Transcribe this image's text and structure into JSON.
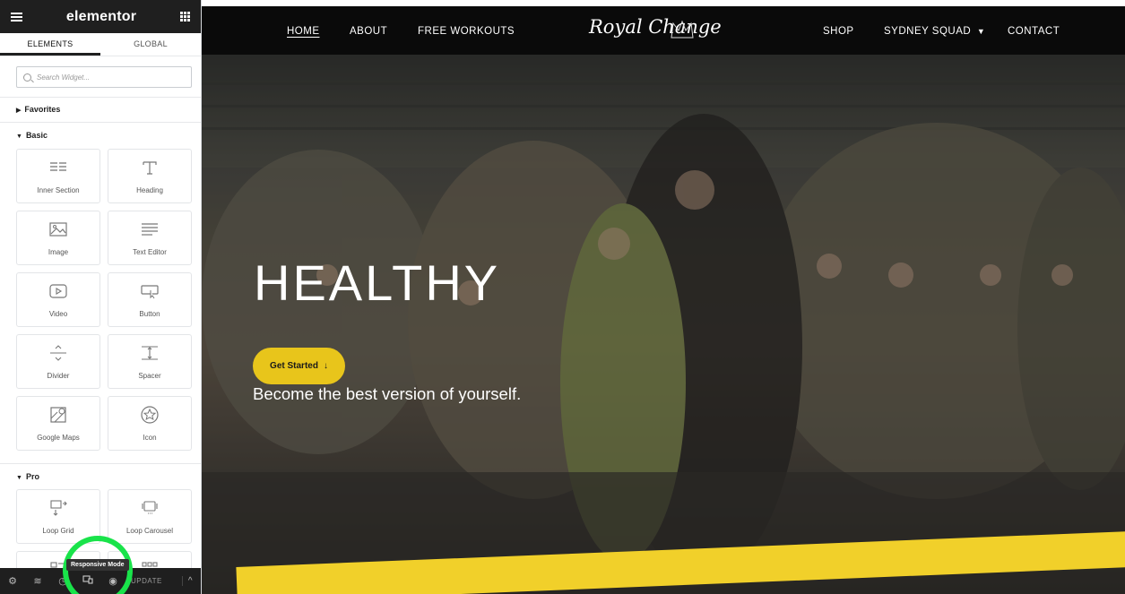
{
  "editor": {
    "logo": "elementor",
    "tabs": [
      {
        "label": "ELEMENTS"
      },
      {
        "label": "GLOBAL"
      }
    ],
    "search_placeholder": "Search Widget...",
    "categories": {
      "favorites": "Favorites",
      "basic": "Basic",
      "pro": "Pro"
    },
    "basic_widgets": [
      {
        "label": "Inner Section",
        "icon": "inner-section-icon"
      },
      {
        "label": "Heading",
        "icon": "heading-icon"
      },
      {
        "label": "Image",
        "icon": "image-icon"
      },
      {
        "label": "Text Editor",
        "icon": "text-editor-icon"
      },
      {
        "label": "Video",
        "icon": "video-icon"
      },
      {
        "label": "Button",
        "icon": "button-icon"
      },
      {
        "label": "Divider",
        "icon": "divider-icon"
      },
      {
        "label": "Spacer",
        "icon": "spacer-icon"
      },
      {
        "label": "Google Maps",
        "icon": "google-maps-icon"
      },
      {
        "label": "Icon",
        "icon": "star-icon"
      }
    ],
    "pro_widgets": [
      {
        "label": "Loop Grid",
        "icon": "loop-grid-icon"
      },
      {
        "label": "Loop Carousel",
        "icon": "loop-carousel-icon"
      }
    ],
    "bottom_bar": {
      "update_label": "UPDATE",
      "tooltip": "Responsive Mode"
    },
    "accent_color": "#19e34a"
  },
  "site": {
    "nav": {
      "home": "HOME",
      "about": "ABOUT",
      "free_workouts": "FREE WORKOUTS",
      "brand": "Royal Change",
      "shop": "SHOP",
      "sydney_squad": "SYDNEY SQUAD",
      "contact": "CONTACT"
    },
    "hero": {
      "title": "HEALTHY",
      "cta_label": "Get Started",
      "cta_arrow": "↓",
      "subtitle": "Become the best version of yourself."
    },
    "cta_color": "#e8c51b"
  }
}
